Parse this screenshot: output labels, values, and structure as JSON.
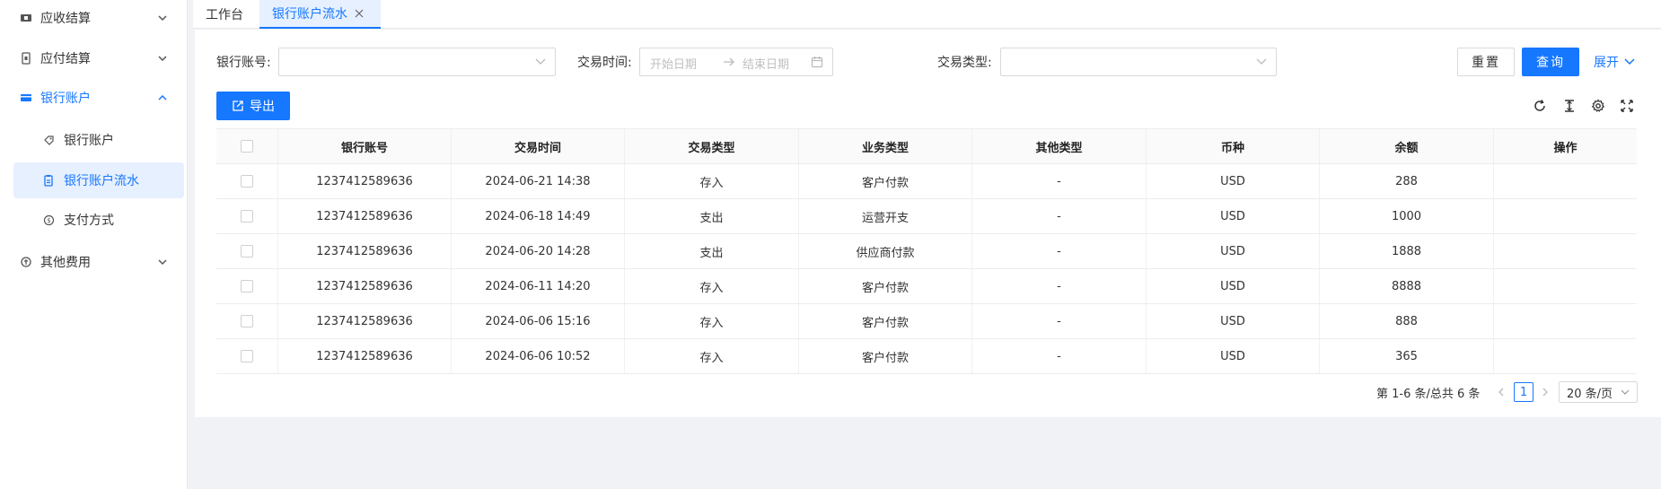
{
  "sidebar": {
    "items": [
      {
        "label": "应收结算",
        "icon": "ticket-icon"
      },
      {
        "label": "应付结算",
        "icon": "invoice-icon"
      },
      {
        "label": "银行账户",
        "icon": "card-icon"
      },
      {
        "label": "其他费用",
        "icon": "coins-icon"
      }
    ],
    "sub_items": [
      {
        "label": "银行账户",
        "icon": "tag-icon"
      },
      {
        "label": "银行账户流水",
        "icon": "clipboard-icon"
      },
      {
        "label": "支付方式",
        "icon": "coin-icon"
      }
    ]
  },
  "tabs": [
    {
      "label": "工作台"
    },
    {
      "label": "银行账户流水"
    }
  ],
  "filters": {
    "account_label": "银行账号:",
    "time_label": "交易时间:",
    "start_placeholder": "开始日期",
    "end_placeholder": "结束日期",
    "type_label": "交易类型:"
  },
  "actions": {
    "reset": "重置",
    "query": "查询",
    "expand": "展开",
    "export": "导出"
  },
  "table": {
    "columns": [
      "银行账号",
      "交易时间",
      "交易类型",
      "业务类型",
      "其他类型",
      "币种",
      "余额",
      "操作"
    ],
    "rows": [
      [
        "1237412589636",
        "2024-06-21 14:38",
        "存入",
        "客户付款",
        "-",
        "USD",
        "288",
        ""
      ],
      [
        "1237412589636",
        "2024-06-18 14:49",
        "支出",
        "运营开支",
        "-",
        "USD",
        "1000",
        ""
      ],
      [
        "1237412589636",
        "2024-06-20 14:28",
        "支出",
        "供应商付款",
        "-",
        "USD",
        "1888",
        ""
      ],
      [
        "1237412589636",
        "2024-06-11 14:20",
        "存入",
        "客户付款",
        "-",
        "USD",
        "8888",
        ""
      ],
      [
        "1237412589636",
        "2024-06-06 15:16",
        "存入",
        "客户付款",
        "-",
        "USD",
        "888",
        ""
      ],
      [
        "1237412589636",
        "2024-06-06 10:52",
        "存入",
        "客户付款",
        "-",
        "USD",
        "365",
        ""
      ]
    ]
  },
  "pagination": {
    "total_text": "第 1-6 条/总共 6 条",
    "current_page": "1",
    "page_size": "20 条/页"
  },
  "colors": {
    "accent": "#1677ff",
    "active_bg": "#e6f0ff"
  }
}
